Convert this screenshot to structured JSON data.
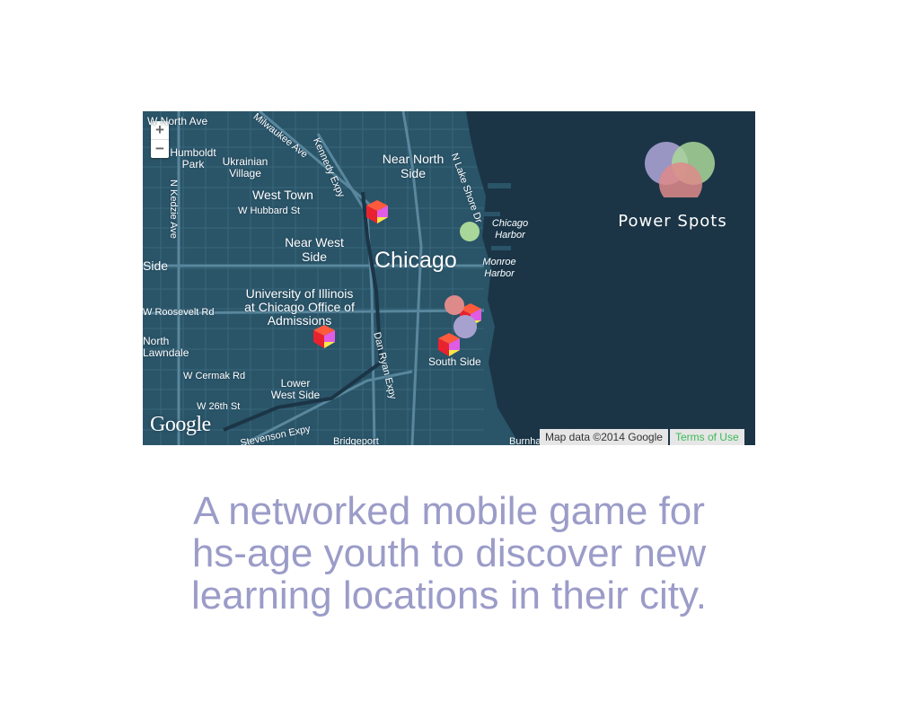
{
  "map": {
    "zoom_in_label": "+",
    "zoom_out_label": "−",
    "city_label": "Chicago",
    "neighborhoods": [
      "W North Ave",
      "Humboldt Park",
      "Ukrainian Village",
      "West Town",
      "W Hubbard St",
      "Near West Side",
      "Near North Side",
      "University of Illinois at Chicago Office of Admissions",
      "W Roosevelt Rd",
      "North Lawndale",
      "W Cermak Rd",
      "Lower West Side",
      "W 26th St",
      "Stevenson Expy",
      "Bridgeport",
      "Burnham",
      "South Side",
      "Chicago Harbor",
      "Monroe Harbor",
      "Side",
      "Milwaukee Ave",
      "Kennedy Expy",
      "N Kedzie Ave",
      "Dan Ryan Expy",
      "N Lake Shore Dr"
    ],
    "google_logo": "Google",
    "attribution": "Map data ©2014 Google",
    "terms": "Terms of Use",
    "brand": "Power Spots",
    "colors": {
      "water": "#1b3546",
      "land": "#2a5468",
      "road": "#5c8aa0",
      "circle_green": "#a9d79a",
      "circle_purple": "#a7a1d0",
      "circle_red": "#de8a8a"
    },
    "markers": [
      {
        "type": "cube-icon",
        "label": "learning-location-west-town"
      },
      {
        "type": "cube-icon",
        "label": "learning-location-uic"
      },
      {
        "type": "cube-icon",
        "label": "learning-location-south-loop-1"
      },
      {
        "type": "cube-icon",
        "label": "learning-location-south-loop-2"
      },
      {
        "type": "circle-icon",
        "label": "power-spot-green"
      },
      {
        "type": "circle-icon",
        "label": "power-spot-red"
      },
      {
        "type": "circle-icon",
        "label": "power-spot-purple"
      }
    ]
  },
  "caption": {
    "line1": "A networked mobile game for",
    "line2": "hs-age youth to discover new",
    "line3": "learning locations in their city."
  }
}
